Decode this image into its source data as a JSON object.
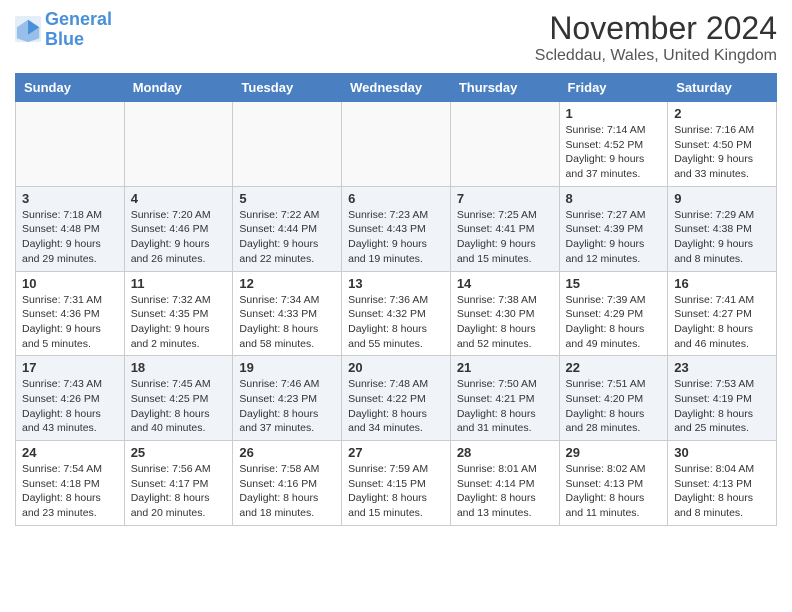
{
  "header": {
    "logo_line1": "General",
    "logo_line2": "Blue",
    "month": "November 2024",
    "location": "Scleddau, Wales, United Kingdom"
  },
  "weekdays": [
    "Sunday",
    "Monday",
    "Tuesday",
    "Wednesday",
    "Thursday",
    "Friday",
    "Saturday"
  ],
  "weeks": [
    [
      {
        "day": "",
        "info": ""
      },
      {
        "day": "",
        "info": ""
      },
      {
        "day": "",
        "info": ""
      },
      {
        "day": "",
        "info": ""
      },
      {
        "day": "",
        "info": ""
      },
      {
        "day": "1",
        "info": "Sunrise: 7:14 AM\nSunset: 4:52 PM\nDaylight: 9 hours and 37 minutes."
      },
      {
        "day": "2",
        "info": "Sunrise: 7:16 AM\nSunset: 4:50 PM\nDaylight: 9 hours and 33 minutes."
      }
    ],
    [
      {
        "day": "3",
        "info": "Sunrise: 7:18 AM\nSunset: 4:48 PM\nDaylight: 9 hours and 29 minutes."
      },
      {
        "day": "4",
        "info": "Sunrise: 7:20 AM\nSunset: 4:46 PM\nDaylight: 9 hours and 26 minutes."
      },
      {
        "day": "5",
        "info": "Sunrise: 7:22 AM\nSunset: 4:44 PM\nDaylight: 9 hours and 22 minutes."
      },
      {
        "day": "6",
        "info": "Sunrise: 7:23 AM\nSunset: 4:43 PM\nDaylight: 9 hours and 19 minutes."
      },
      {
        "day": "7",
        "info": "Sunrise: 7:25 AM\nSunset: 4:41 PM\nDaylight: 9 hours and 15 minutes."
      },
      {
        "day": "8",
        "info": "Sunrise: 7:27 AM\nSunset: 4:39 PM\nDaylight: 9 hours and 12 minutes."
      },
      {
        "day": "9",
        "info": "Sunrise: 7:29 AM\nSunset: 4:38 PM\nDaylight: 9 hours and 8 minutes."
      }
    ],
    [
      {
        "day": "10",
        "info": "Sunrise: 7:31 AM\nSunset: 4:36 PM\nDaylight: 9 hours and 5 minutes."
      },
      {
        "day": "11",
        "info": "Sunrise: 7:32 AM\nSunset: 4:35 PM\nDaylight: 9 hours and 2 minutes."
      },
      {
        "day": "12",
        "info": "Sunrise: 7:34 AM\nSunset: 4:33 PM\nDaylight: 8 hours and 58 minutes."
      },
      {
        "day": "13",
        "info": "Sunrise: 7:36 AM\nSunset: 4:32 PM\nDaylight: 8 hours and 55 minutes."
      },
      {
        "day": "14",
        "info": "Sunrise: 7:38 AM\nSunset: 4:30 PM\nDaylight: 8 hours and 52 minutes."
      },
      {
        "day": "15",
        "info": "Sunrise: 7:39 AM\nSunset: 4:29 PM\nDaylight: 8 hours and 49 minutes."
      },
      {
        "day": "16",
        "info": "Sunrise: 7:41 AM\nSunset: 4:27 PM\nDaylight: 8 hours and 46 minutes."
      }
    ],
    [
      {
        "day": "17",
        "info": "Sunrise: 7:43 AM\nSunset: 4:26 PM\nDaylight: 8 hours and 43 minutes."
      },
      {
        "day": "18",
        "info": "Sunrise: 7:45 AM\nSunset: 4:25 PM\nDaylight: 8 hours and 40 minutes."
      },
      {
        "day": "19",
        "info": "Sunrise: 7:46 AM\nSunset: 4:23 PM\nDaylight: 8 hours and 37 minutes."
      },
      {
        "day": "20",
        "info": "Sunrise: 7:48 AM\nSunset: 4:22 PM\nDaylight: 8 hours and 34 minutes."
      },
      {
        "day": "21",
        "info": "Sunrise: 7:50 AM\nSunset: 4:21 PM\nDaylight: 8 hours and 31 minutes."
      },
      {
        "day": "22",
        "info": "Sunrise: 7:51 AM\nSunset: 4:20 PM\nDaylight: 8 hours and 28 minutes."
      },
      {
        "day": "23",
        "info": "Sunrise: 7:53 AM\nSunset: 4:19 PM\nDaylight: 8 hours and 25 minutes."
      }
    ],
    [
      {
        "day": "24",
        "info": "Sunrise: 7:54 AM\nSunset: 4:18 PM\nDaylight: 8 hours and 23 minutes."
      },
      {
        "day": "25",
        "info": "Sunrise: 7:56 AM\nSunset: 4:17 PM\nDaylight: 8 hours and 20 minutes."
      },
      {
        "day": "26",
        "info": "Sunrise: 7:58 AM\nSunset: 4:16 PM\nDaylight: 8 hours and 18 minutes."
      },
      {
        "day": "27",
        "info": "Sunrise: 7:59 AM\nSunset: 4:15 PM\nDaylight: 8 hours and 15 minutes."
      },
      {
        "day": "28",
        "info": "Sunrise: 8:01 AM\nSunset: 4:14 PM\nDaylight: 8 hours and 13 minutes."
      },
      {
        "day": "29",
        "info": "Sunrise: 8:02 AM\nSunset: 4:13 PM\nDaylight: 8 hours and 11 minutes."
      },
      {
        "day": "30",
        "info": "Sunrise: 8:04 AM\nSunset: 4:13 PM\nDaylight: 8 hours and 8 minutes."
      }
    ]
  ]
}
